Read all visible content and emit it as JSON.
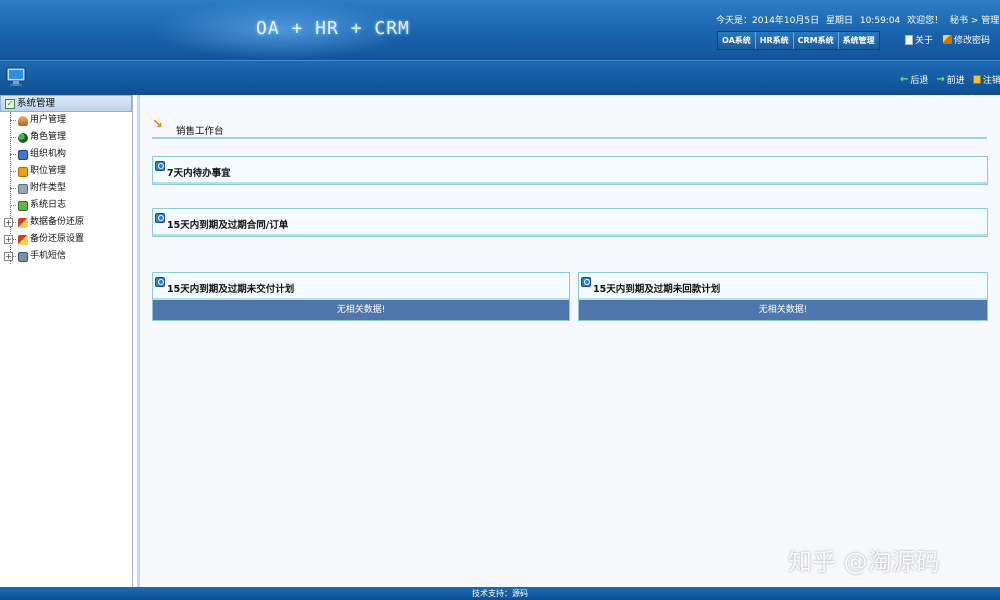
{
  "header": {
    "app_title": "OA + HR + CRM",
    "date_label": "今天是：2014年10月5日",
    "weekday": "星期日",
    "time": "10:59:04",
    "welcome": "欢迎您！",
    "user_path": "秘书 > 管理员",
    "system_tabs": [
      "OA系统",
      "HR系统",
      "CRM系统",
      "系统管理"
    ],
    "about_label": "关于",
    "change_password_label": "修改密码"
  },
  "toolbar": {
    "back_label": "后退",
    "forward_label": "前进",
    "logout_label": "注销"
  },
  "sidebar": {
    "root_label": "系统管理",
    "items": [
      {
        "label": "用户管理",
        "icon": "user-icon",
        "expandable": false
      },
      {
        "label": "角色管理",
        "icon": "role-icon",
        "expandable": false
      },
      {
        "label": "组织机构",
        "icon": "org-icon",
        "expandable": false
      },
      {
        "label": "职位管理",
        "icon": "post-icon",
        "expandable": false
      },
      {
        "label": "附件类型",
        "icon": "attachment-icon",
        "expandable": false
      },
      {
        "label": "系统日志",
        "icon": "log-icon",
        "expandable": false
      },
      {
        "label": "数据备份还原",
        "icon": "backup-icon",
        "expandable": true
      },
      {
        "label": "备份还原设置",
        "icon": "backup-settings-icon",
        "expandable": true
      },
      {
        "label": "手机短信",
        "icon": "phone-icon",
        "expandable": true
      }
    ]
  },
  "main": {
    "workspace_title": "销售工作台",
    "panels": [
      {
        "title": "7天内待办事宜",
        "no_data": ""
      },
      {
        "title": "15天内到期及过期合同/订单",
        "no_data": ""
      },
      {
        "title": "15天内到期及过期未交付计划",
        "no_data": "无相关数据!"
      },
      {
        "title": "15天内到期及过期未回款计划",
        "no_data": "无相关数据!"
      }
    ]
  },
  "footer": {
    "support_text": "技术支持：源码"
  },
  "watermark": {
    "text": "知乎 @淘源码"
  }
}
